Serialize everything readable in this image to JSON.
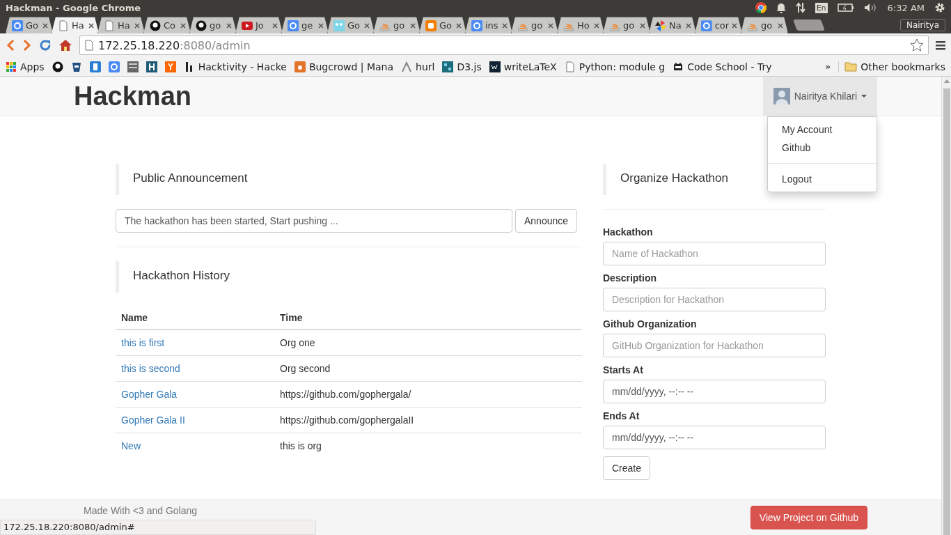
{
  "window": {
    "title": "Hackman - Google Chrome"
  },
  "tray": {
    "language": "En",
    "time": "6:32 AM"
  },
  "tabs": [
    {
      "label": "Go",
      "kind": "google",
      "selected": false
    },
    {
      "label": "Ha",
      "kind": "page",
      "selected": true
    },
    {
      "label": "Ha",
      "kind": "page",
      "selected": false
    },
    {
      "label": "Co",
      "kind": "github",
      "selected": false
    },
    {
      "label": "go",
      "kind": "github",
      "selected": false
    },
    {
      "label": "Jo",
      "kind": "youtube",
      "selected": false
    },
    {
      "label": "ge",
      "kind": "google",
      "selected": false
    },
    {
      "label": "Go",
      "kind": "gopher",
      "selected": false
    },
    {
      "label": "go",
      "kind": "stack",
      "selected": false
    },
    {
      "label": "Go",
      "kind": "blogger",
      "selected": false
    },
    {
      "label": "ins",
      "kind": "google",
      "selected": false
    },
    {
      "label": "go",
      "kind": "stack",
      "selected": false
    },
    {
      "label": "Ho",
      "kind": "stack",
      "selected": false
    },
    {
      "label": "go",
      "kind": "stack",
      "selected": false
    },
    {
      "label": "Na",
      "kind": "pinwheel",
      "selected": false
    },
    {
      "label": "cor",
      "kind": "google",
      "selected": false
    },
    {
      "label": "go",
      "kind": "stack",
      "selected": false
    }
  ],
  "profile": "Nairitya",
  "address": {
    "host": "172.25.18.220",
    "rest": ":8080/admin"
  },
  "bookmarks": [
    {
      "kind": "apps",
      "label": "Apps"
    },
    {
      "kind": "github"
    },
    {
      "kind": "bucket"
    },
    {
      "kind": "blue"
    },
    {
      "kind": "google"
    },
    {
      "kind": "ideone"
    },
    {
      "kind": "h"
    },
    {
      "kind": "y"
    },
    {
      "kind": "hackerone",
      "label": "Hacktivity - Hacke"
    },
    {
      "kind": "bugcrowd",
      "label": "Bugcrowd | Mana"
    },
    {
      "kind": "hurl",
      "label": "hurl"
    },
    {
      "kind": "d3",
      "label": "D3.js"
    },
    {
      "kind": "wl",
      "label": "writeLaTeX"
    },
    {
      "kind": "page",
      "label": "Python: module g"
    },
    {
      "kind": "codeschool",
      "label": "Code School - Try"
    }
  ],
  "bookmarks_more": "»",
  "other_bookmarks": "Other bookmarks",
  "navbar": {
    "brand": "Hackman",
    "user": "Nairitya Khilari",
    "expanded": true,
    "menu": [
      {
        "kind": "link",
        "label": "My Account"
      },
      {
        "kind": "link",
        "label": "Github"
      },
      {
        "kind": "divider"
      },
      {
        "kind": "link",
        "label": "Logout"
      }
    ]
  },
  "announcement": {
    "heading": "Public Announcement",
    "value": "The hackathon has been started, Start pushing ...",
    "button": "Announce"
  },
  "history": {
    "heading": "Hackathon History",
    "columns": [
      "Name",
      "Time"
    ],
    "rows": [
      {
        "name": "this is first",
        "time": "Org one"
      },
      {
        "name": "this is second",
        "time": "Org second"
      },
      {
        "name": "Gopher Gala",
        "time": "https://github.com/gophergala/"
      },
      {
        "name": "Gopher Gala II",
        "time": "https://github.com/gophergalaII"
      },
      {
        "name": "New",
        "time": "this is org"
      }
    ]
  },
  "organize": {
    "heading": "Organize Hackathon",
    "fields": [
      {
        "label": "Hackathon",
        "kind": "text",
        "placeholder": "Name of Hackathon"
      },
      {
        "label": "Description",
        "kind": "text",
        "placeholder": "Description for Hackathon"
      },
      {
        "label": "Github Organization",
        "kind": "text",
        "placeholder": "GitHub Organization for Hackathon"
      },
      {
        "label": "Starts At",
        "kind": "datetime",
        "placeholder": "mm/dd/yyyy, --:-- --"
      },
      {
        "label": "Ends At",
        "kind": "datetime",
        "placeholder": "mm/dd/yyyy, --:-- --"
      }
    ],
    "button": "Create"
  },
  "footer": {
    "text": "Made With <3 and Golang",
    "button": "View Project on Github"
  },
  "status_bar": {
    "url": "172.25.18.220:8080/admin#"
  }
}
